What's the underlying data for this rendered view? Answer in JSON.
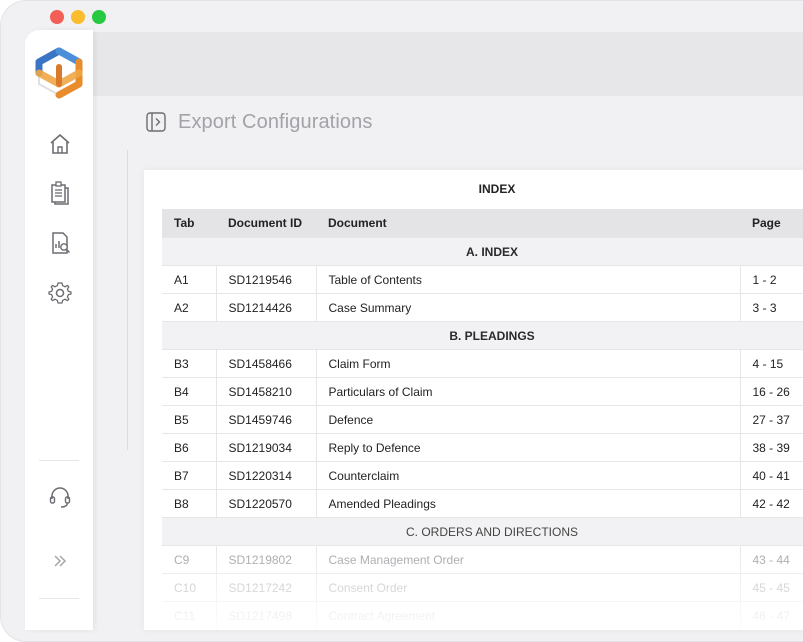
{
  "window": {
    "traffic_colors": [
      "#f25f57",
      "#fbbc2e",
      "#28c840"
    ]
  },
  "sidebar": {
    "logo": "cube-logo-icon",
    "items": [
      {
        "icon": "home-icon"
      },
      {
        "icon": "documents-icon"
      },
      {
        "icon": "report-search-icon"
      },
      {
        "icon": "gear-icon"
      },
      {
        "icon": "headset-support-icon"
      },
      {
        "icon": "double-chevron-right-icon"
      }
    ]
  },
  "page": {
    "title": "Export Configurations",
    "title_icon": "panel-toggle-icon"
  },
  "index": {
    "title": "INDEX",
    "columns": [
      "Tab",
      "Document ID",
      "Document",
      "Page"
    ],
    "sections": [
      {
        "heading": "A. INDEX",
        "rows": [
          {
            "tab": "A1",
            "doc_id": "SD1219546",
            "document": "Table of Contents",
            "page": "1 - 2"
          },
          {
            "tab": "A2",
            "doc_id": "SD1214426",
            "document": "Case Summary",
            "page": "3 - 3"
          }
        ]
      },
      {
        "heading": "B. PLEADINGS",
        "rows": [
          {
            "tab": "B3",
            "doc_id": "SD1458466",
            "document": "Claim Form",
            "page": "4 - 15"
          },
          {
            "tab": "B4",
            "doc_id": "SD1458210",
            "document": "Particulars of Claim",
            "page": "16 - 26"
          },
          {
            "tab": "B5",
            "doc_id": "SD1459746",
            "document": "Defence",
            "page": "27 - 37"
          },
          {
            "tab": "B6",
            "doc_id": "SD1219034",
            "document": "Reply to Defence",
            "page": "38 - 39"
          },
          {
            "tab": "B7",
            "doc_id": "SD1220314",
            "document": "Counterclaim",
            "page": "40 - 41"
          },
          {
            "tab": "B8",
            "doc_id": "SD1220570",
            "document": "Amended Pleadings",
            "page": "42 - 42"
          }
        ]
      },
      {
        "heading": "C. ORDERS AND DIRECTIONS",
        "rows": [
          {
            "tab": "C9",
            "doc_id": "SD1219802",
            "document": "Case Management Order",
            "page": "43 - 44"
          },
          {
            "tab": "C10",
            "doc_id": "SD1217242",
            "document": "Consent Order",
            "page": "45 - 45"
          },
          {
            "tab": "C11",
            "doc_id": "SD1217498",
            "document": "Contract Agreement",
            "page": "46 - 47"
          }
        ]
      }
    ]
  }
}
